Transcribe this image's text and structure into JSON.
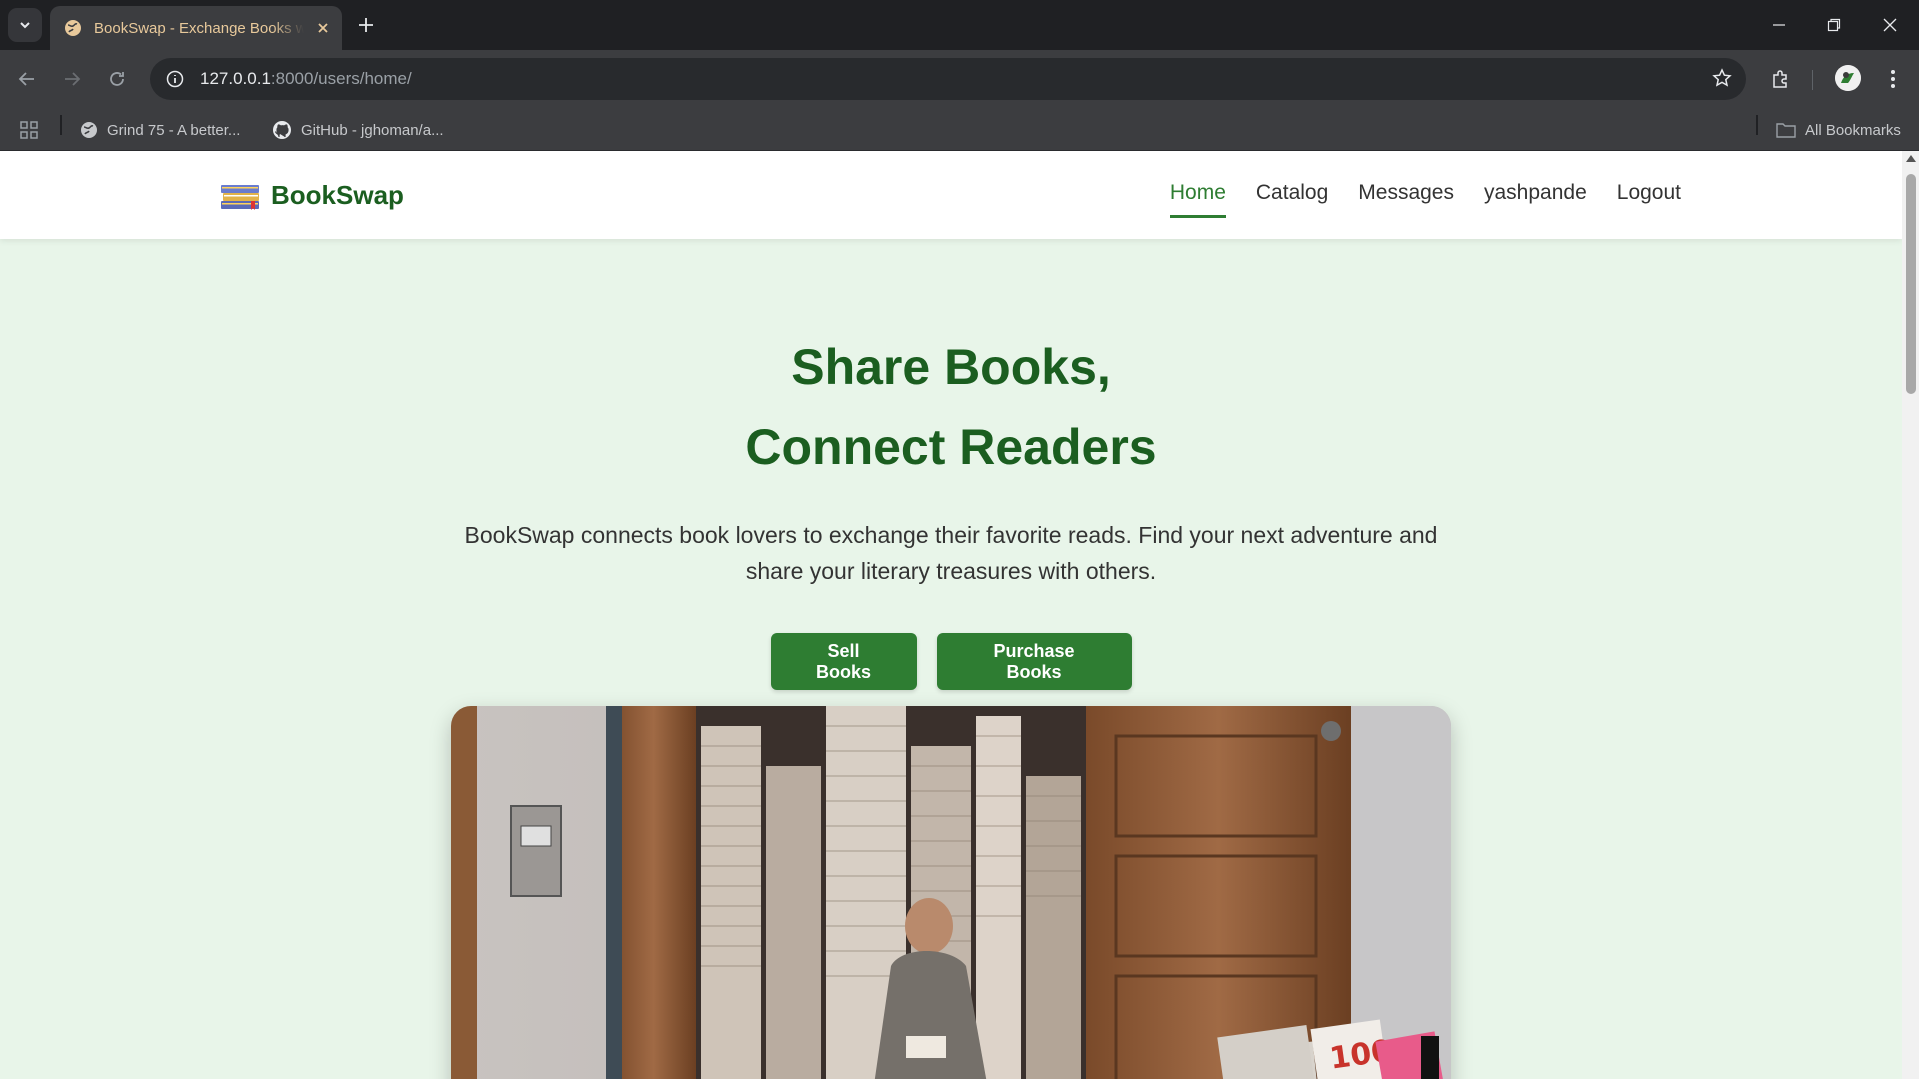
{
  "browser": {
    "tab_title": "BookSwap - Exchange Books with Readers",
    "url_host": "127.0.0.1",
    "url_rest": ":8000/users/home/",
    "bookmarks": [
      {
        "label": "Grind 75 - A better...",
        "icon": "globe-icon"
      },
      {
        "label": "GitHub - jghoman/a...",
        "icon": "github-icon"
      }
    ],
    "all_bookmarks_label": "All Bookmarks"
  },
  "site": {
    "brand": "BookSwap",
    "nav": [
      {
        "label": "Home",
        "active": true
      },
      {
        "label": "Catalog"
      },
      {
        "label": "Messages"
      },
      {
        "label": "yashpande"
      },
      {
        "label": "Logout"
      }
    ]
  },
  "hero": {
    "title_line1": "Share Books,",
    "title_line2": "Connect Readers",
    "lead": "BookSwap connects book lovers to exchange their favorite reads. Find your next adventure and share your literary treasures with others.",
    "primary_button": "Sell Books",
    "secondary_button": "Purchase Books",
    "image": "bookshop-photo"
  },
  "colors": {
    "brand_green": "#1b5e20",
    "button_green": "#2e7d32",
    "page_bg": "#e8f5e9"
  }
}
